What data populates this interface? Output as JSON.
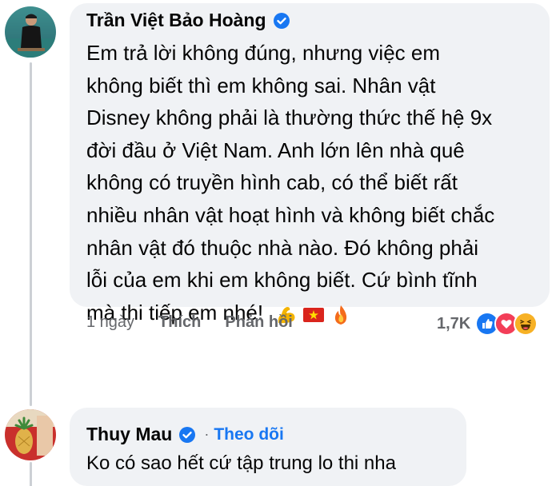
{
  "comments": [
    {
      "author": "Trần Việt Bảo Hoàng",
      "verified": true,
      "lines": [
        "Em trả lời không đúng, nhưng việc em",
        "không biết thì em không sai. Nhân vật",
        "Disney không phải là thường thức thế hệ 9x",
        "đời đầu ở Việt Nam. Anh lớn lên nhà quê",
        "không có truyền hình cab, có thể biết rất",
        "nhiều nhân vật hoạt hình và không biết chắc",
        "nhân vật đó thuộc nhà nào. Đó không phải",
        "lỗi của em khi em không biết. Cứ bình tĩnh",
        "mà thi tiếp em nhé!"
      ],
      "emojis": [
        "flexed-biceps-icon",
        "vietnam-flag-icon",
        "fire-icon"
      ],
      "time": "1 ngày",
      "like_label": "Thích",
      "reply_label": "Phản hồi",
      "reaction_count": "1,7K",
      "reactions": [
        "like-reaction-icon",
        "love-reaction-icon",
        "haha-reaction-icon"
      ]
    },
    {
      "author": "Thuy Mau",
      "verified": true,
      "separator": "·",
      "follow_label": "Theo dõi",
      "text": "Ko có sao hết cứ tập trung lo thi nha"
    }
  ],
  "colors": {
    "bubble": "#f0f2f5",
    "verified": "#1877f2",
    "link": "#1877f2",
    "muted": "#65676b"
  }
}
